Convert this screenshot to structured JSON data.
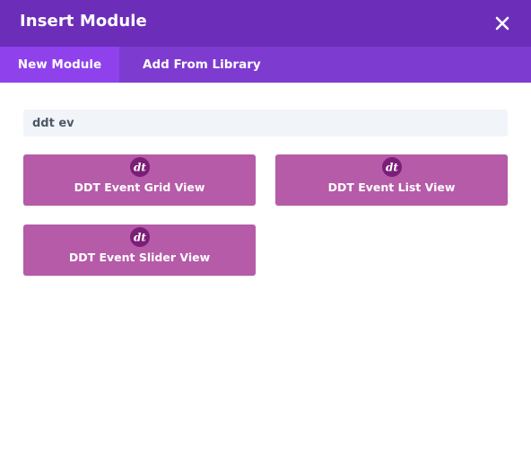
{
  "header": {
    "title": "Insert Module",
    "close_icon": "close-icon"
  },
  "tabs": [
    {
      "label": "New Module",
      "active": true
    },
    {
      "label": "Add From Library",
      "active": false
    }
  ],
  "search": {
    "value": "ddt ev",
    "placeholder": ""
  },
  "modules": [
    {
      "label": "DDT Event Grid View",
      "icon": "ddt-logo-icon",
      "icon_text": "dt"
    },
    {
      "label": "DDT Event List View",
      "icon": "ddt-logo-icon",
      "icon_text": "dt"
    },
    {
      "label": "DDT Event Slider View",
      "icon": "ddt-logo-icon",
      "icon_text": "dt"
    }
  ],
  "colors": {
    "header_bg": "#6c2eb9",
    "tabs_bg": "#7e3bd0",
    "active_tab_bg": "#8f42ec",
    "module_bg": "#b55ba8",
    "logo_circle": "#7a1e78",
    "search_bg": "#f1f5f9"
  }
}
